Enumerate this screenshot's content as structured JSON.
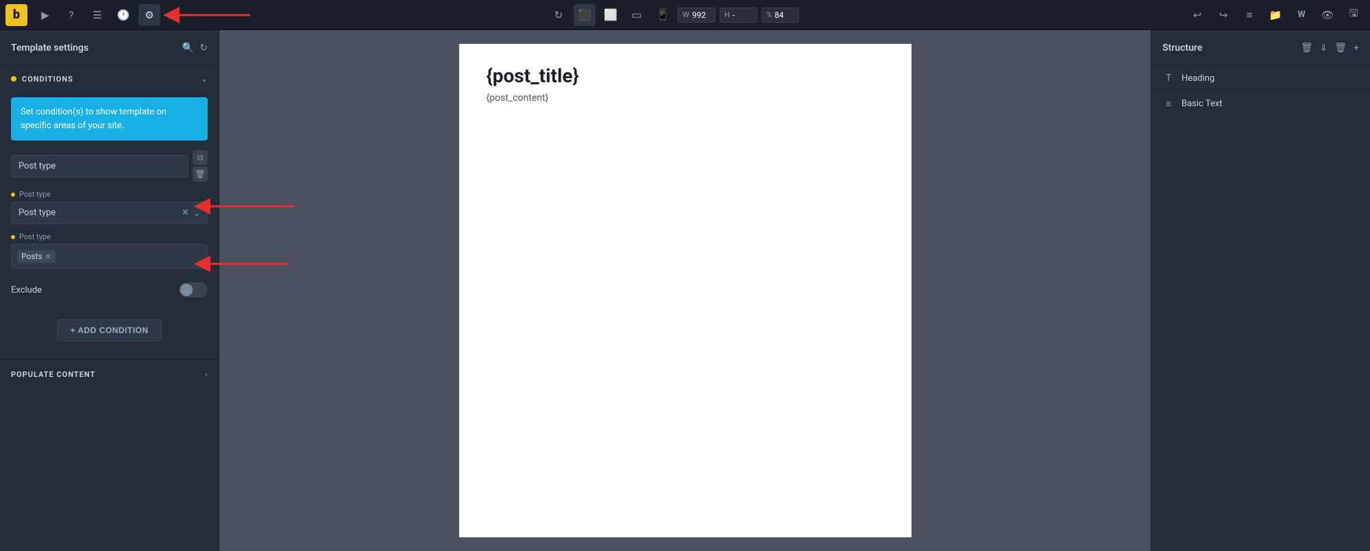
{
  "toolbar": {
    "logo": "b",
    "icons": [
      "▶",
      "?",
      "☰",
      "🕐",
      "⚙"
    ],
    "active_icon": 4,
    "view_icons": [
      "↺",
      "🖥",
      "⬜",
      "📱"
    ],
    "active_view": 1,
    "width_label": "W",
    "width_value": "992",
    "height_label": "H",
    "height_value": "-",
    "zoom_label": "%",
    "zoom_value": "84",
    "right_icons": [
      "↩",
      "↪",
      "≡",
      "📁",
      "W",
      "👁",
      "💾"
    ]
  },
  "left_panel": {
    "title": "Template settings",
    "search_icon": "🔍",
    "reset_icon": "↺",
    "conditions_section": {
      "label": "CONDITIONS",
      "dot_color": "#f0c020",
      "info_text": "Set condition(s) to show template on specific areas of your site.",
      "rows": [
        {
          "label": "Post type",
          "type": "select_with_btns",
          "value": ""
        },
        {
          "label": "Post type",
          "type": "select_with_x",
          "value": "Post type"
        },
        {
          "label": "Post type",
          "type": "tags",
          "tags": [
            "Posts"
          ]
        }
      ],
      "exclude_label": "Exclude",
      "add_condition_label": "+ ADD CONDITION"
    },
    "populate_section": {
      "label": "POPULATE CONTENT"
    }
  },
  "canvas": {
    "title": "{post_title}",
    "body": "{post_content}"
  },
  "right_panel": {
    "title": "Structure",
    "items": [
      {
        "icon": "T",
        "label": "Heading"
      },
      {
        "icon": "≡",
        "label": "Basic Text"
      }
    ]
  }
}
